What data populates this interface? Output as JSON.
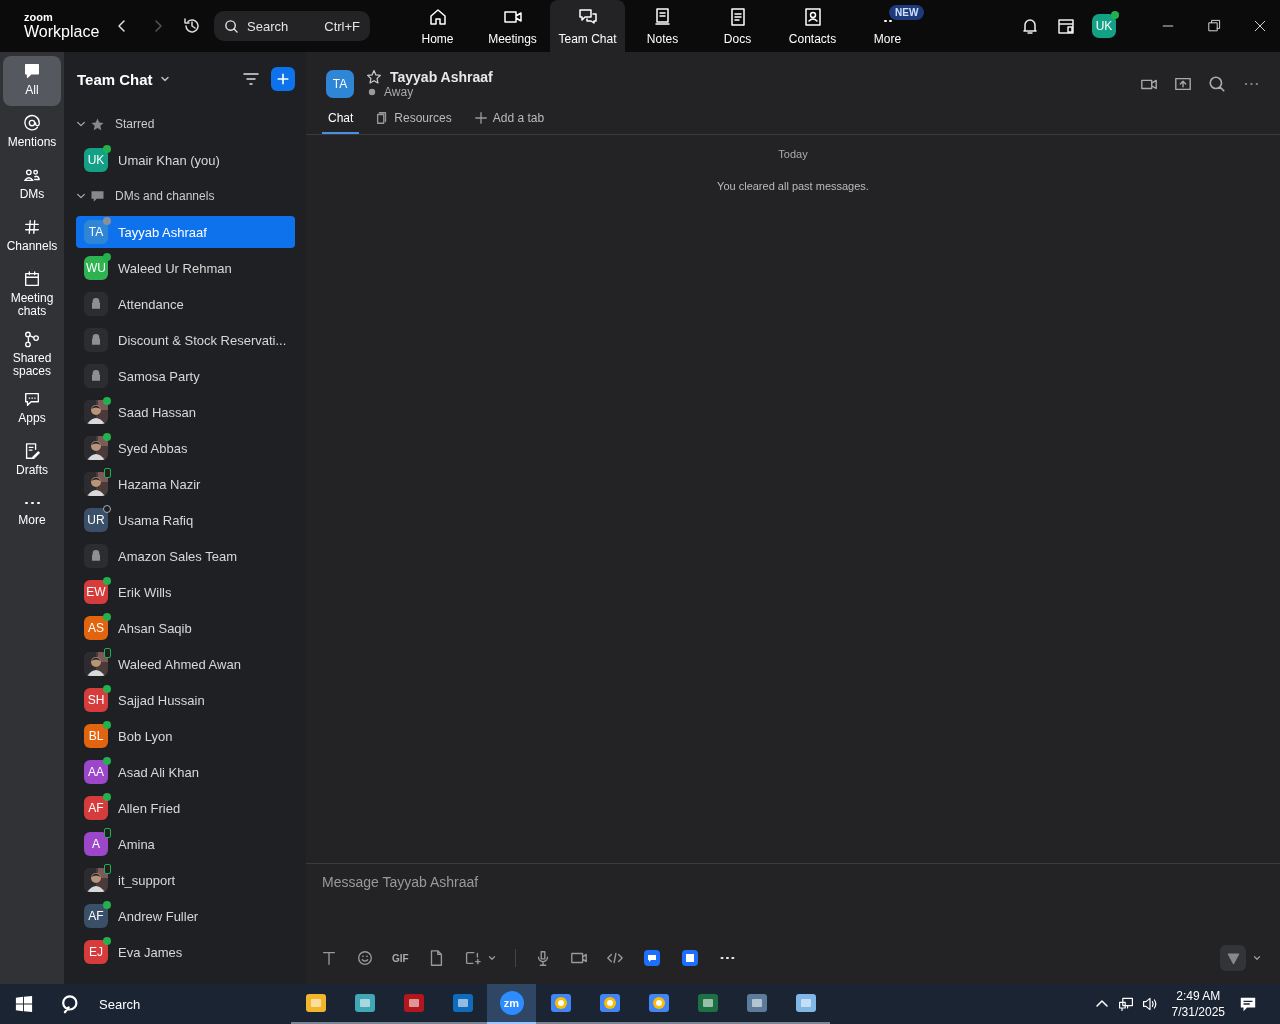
{
  "app": {
    "brand": "zoom",
    "product": "Workplace"
  },
  "search": {
    "placeholder": "Search",
    "shortcut": "Ctrl+F"
  },
  "nav_tabs": [
    {
      "label": "Home",
      "selected": false
    },
    {
      "label": "Meetings",
      "selected": false
    },
    {
      "label": "Team Chat",
      "selected": true
    },
    {
      "label": "Notes",
      "selected": false
    },
    {
      "label": "Docs",
      "selected": false
    },
    {
      "label": "Contacts",
      "selected": false
    },
    {
      "label": "More",
      "selected": false,
      "badge": "NEW"
    }
  ],
  "profile": {
    "initials": "UK",
    "color": "#14a085",
    "presence": {
      "kind": "online"
    }
  },
  "rail": [
    {
      "label": "All",
      "selected": true
    },
    {
      "label": "Mentions",
      "selected": false
    },
    {
      "label": "DMs",
      "selected": false
    },
    {
      "label": "Channels",
      "selected": false
    },
    {
      "label": "Meeting chats",
      "selected": false
    },
    {
      "label": "Shared spaces",
      "selected": false
    },
    {
      "label": "Apps",
      "selected": false
    },
    {
      "label": "Drafts",
      "selected": false
    },
    {
      "label": "More",
      "selected": false
    }
  ],
  "sidebar": {
    "title": "Team Chat",
    "sections": [
      {
        "title": "Starred",
        "expanded": true,
        "items": [
          {
            "name": "Umair Khan (you)",
            "kind": "initials",
            "initials": "UK",
            "color": "#14a085",
            "presence": {
              "kind": "online"
            },
            "selected": false
          }
        ]
      },
      {
        "title": "DMs and channels",
        "expanded": true,
        "items": [
          {
            "name": "Tayyab Ashraaf",
            "kind": "initials",
            "initials": "TA",
            "color": "#2f86d6",
            "presence": {
              "kind": "away"
            },
            "selected": true
          },
          {
            "name": "Waleed Ur Rehman",
            "kind": "initials",
            "initials": "WU",
            "color": "#2fb350",
            "presence": {
              "kind": "online"
            },
            "selected": false
          },
          {
            "name": "Attendance",
            "kind": "lock",
            "selected": false
          },
          {
            "name": "Discount & Stock Reservati...",
            "kind": "lock",
            "selected": false
          },
          {
            "name": "Samosa Party",
            "kind": "lock",
            "selected": false
          },
          {
            "name": "Saad Hassan",
            "presence": {
              "kind": "online"
            },
            "selected": false
          },
          {
            "name": "Syed Abbas",
            "presence": {
              "kind": "online"
            },
            "selected": false
          },
          {
            "name": "Hazama Nazir",
            "presence": {
              "kind": "mobile"
            },
            "selected": false
          },
          {
            "name": "Usama Rafiq",
            "kind": "initials",
            "initials": "UR",
            "color": "#3a5068",
            "presence": {
              "kind": "offline"
            },
            "selected": false
          },
          {
            "name": "Amazon Sales Team",
            "kind": "lock",
            "selected": false
          },
          {
            "name": "Erik Wills",
            "kind": "initials",
            "initials": "EW",
            "color": "#d63c3c",
            "presence": {
              "kind": "online"
            },
            "selected": false
          },
          {
            "name": "Ahsan Saqib",
            "kind": "initials",
            "initials": "AS",
            "color": "#e2640f",
            "presence": {
              "kind": "online"
            },
            "selected": false
          },
          {
            "name": "Waleed Ahmed Awan",
            "presence": {
              "kind": "mobile"
            },
            "selected": false
          },
          {
            "name": "Sajjad Hussain",
            "kind": "initials",
            "initials": "SH",
            "color": "#d63c3c",
            "presence": {
              "kind": "online"
            },
            "selected": false
          },
          {
            "name": "Bob Lyon",
            "kind": "initials",
            "initials": "BL",
            "color": "#e2640f",
            "presence": {
              "kind": "online"
            },
            "selected": false
          },
          {
            "name": "Asad Ali Khan",
            "kind": "initials",
            "initials": "AA",
            "color": "#9c46c9",
            "presence": {
              "kind": "online"
            },
            "selected": false
          },
          {
            "name": "Allen Fried",
            "kind": "initials",
            "initials": "AF",
            "color": "#d63c3c",
            "presence": {
              "kind": "online"
            },
            "selected": false
          },
          {
            "name": "Amina",
            "kind": "initials",
            "initials": "A",
            "color": "#9c46c9",
            "presence": {
              "kind": "mobile"
            },
            "selected": false
          },
          {
            "name": "it_support",
            "presence": {
              "kind": "mobile"
            },
            "selected": false
          },
          {
            "name": "Andrew Fuller",
            "kind": "initials",
            "initials": "AF",
            "color": "#3a5068",
            "presence": {
              "kind": "online"
            },
            "selected": false
          },
          {
            "name": "Eva James",
            "kind": "initials",
            "initials": "EJ",
            "color": "#d63c3c",
            "presence": {
              "kind": "online"
            },
            "selected": false
          }
        ]
      }
    ]
  },
  "conversation": {
    "initials": "TA",
    "color": "#2f86d6",
    "name": "Tayyab Ashraaf",
    "status": "Away",
    "tabs": [
      {
        "label": "Chat",
        "selected": true
      },
      {
        "label": "Resources",
        "selected": false
      },
      {
        "label": "Add a tab",
        "selected": false
      }
    ],
    "messages": [
      {
        "kind": "date",
        "text": "Today"
      },
      {
        "kind": "system",
        "text": "You cleared all past messages."
      }
    ],
    "composer": {
      "placeholder": "Message Tayyab Ashraaf",
      "gif_label": "GIF"
    }
  },
  "taskbar": {
    "search": "Search",
    "apps": [
      {
        "selected": false
      },
      {
        "selected": false
      },
      {
        "selected": false
      },
      {
        "selected": false
      },
      {
        "selected": true,
        "label": "zm"
      },
      {
        "selected": false
      },
      {
        "selected": false
      },
      {
        "selected": false
      },
      {
        "selected": false
      },
      {
        "selected": false
      },
      {
        "selected": false
      }
    ],
    "time": "2:49 AM",
    "date": "7/31/2025"
  }
}
